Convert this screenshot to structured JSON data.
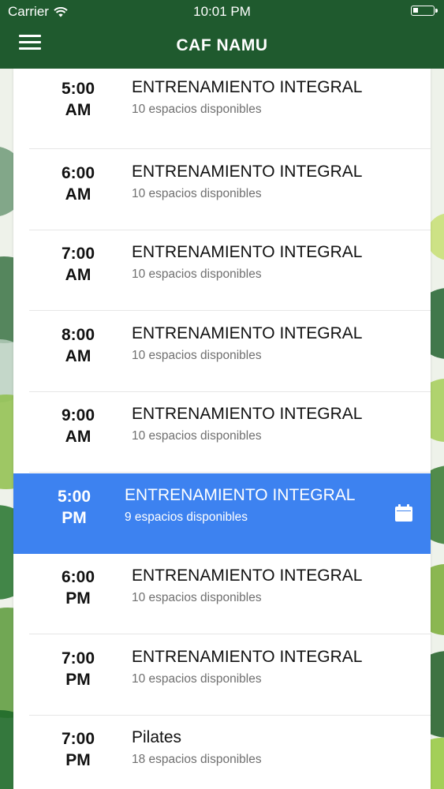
{
  "status_bar": {
    "carrier": "Carrier",
    "time": "10:01 PM",
    "wifi_icon": "wifi-icon",
    "battery_icon": "battery-icon"
  },
  "nav": {
    "title": "CAF NAMU",
    "menu_icon": "hamburger-menu-icon",
    "color": "#1f5a2e"
  },
  "accent_color": "#3d82f0",
  "schedule": [
    {
      "hour": "5:00",
      "period": "AM",
      "name": "ENTRENAMIENTO INTEGRAL",
      "availability": "10 espacios disponibles",
      "selected": false
    },
    {
      "hour": "6:00",
      "period": "AM",
      "name": "ENTRENAMIENTO INTEGRAL",
      "availability": "10 espacios disponibles",
      "selected": false
    },
    {
      "hour": "7:00",
      "period": "AM",
      "name": "ENTRENAMIENTO INTEGRAL",
      "availability": "10 espacios disponibles",
      "selected": false
    },
    {
      "hour": "8:00",
      "period": "AM",
      "name": "ENTRENAMIENTO INTEGRAL",
      "availability": "10 espacios disponibles",
      "selected": false
    },
    {
      "hour": "9:00",
      "period": "AM",
      "name": "ENTRENAMIENTO INTEGRAL",
      "availability": "10 espacios disponibles",
      "selected": false
    },
    {
      "hour": "5:00",
      "period": "PM",
      "name": "ENTRENAMIENTO INTEGRAL",
      "availability": "9 espacios disponibles",
      "selected": true,
      "icon": "calendar-icon"
    },
    {
      "hour": "6:00",
      "period": "PM",
      "name": "ENTRENAMIENTO INTEGRAL",
      "availability": "10 espacios disponibles",
      "selected": false
    },
    {
      "hour": "7:00",
      "period": "PM",
      "name": "ENTRENAMIENTO INTEGRAL",
      "availability": "10 espacios disponibles",
      "selected": false
    },
    {
      "hour": "7:00",
      "period": "PM",
      "name": "Pilates",
      "availability": "18 espacios disponibles",
      "selected": false
    }
  ]
}
